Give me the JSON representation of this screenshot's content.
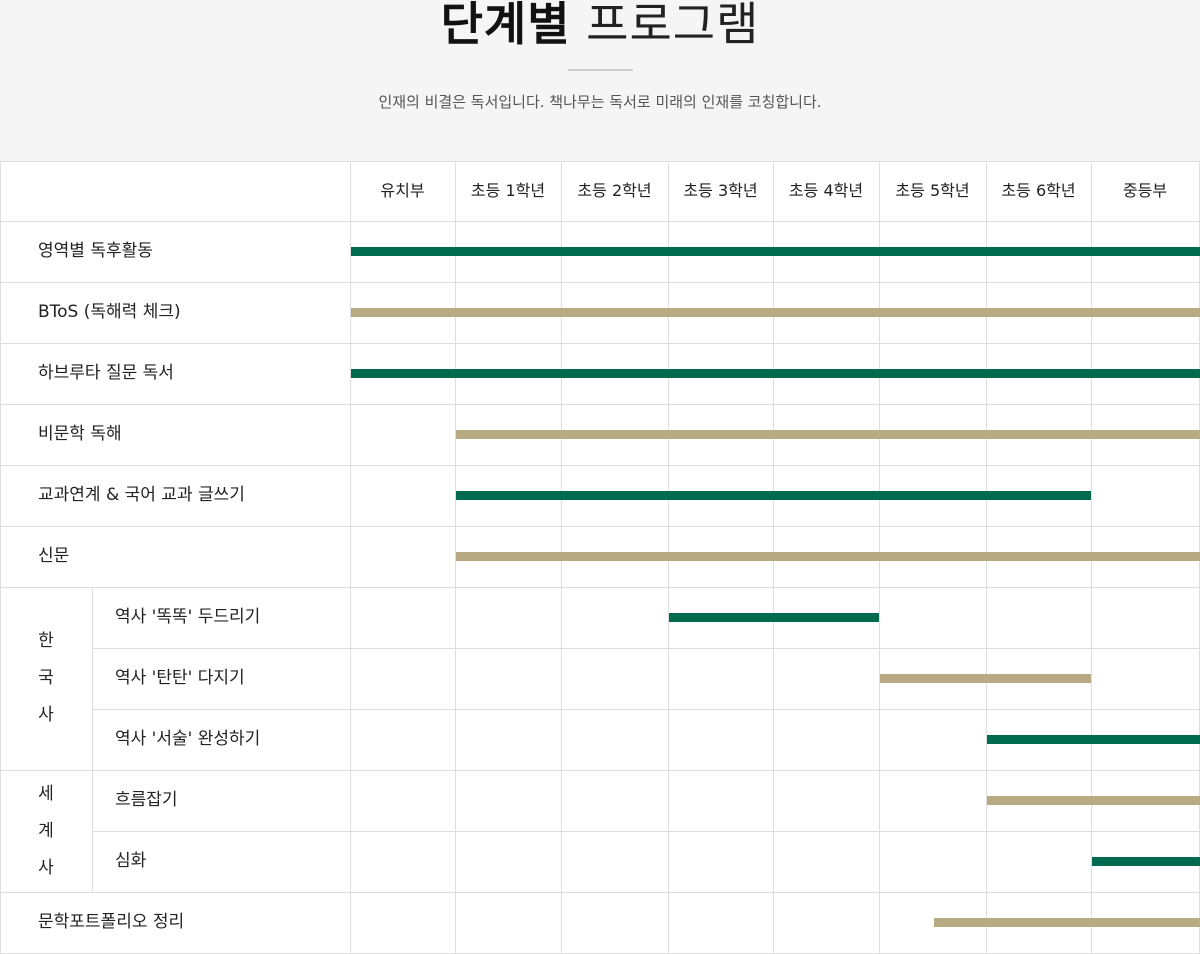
{
  "header": {
    "title_bold": "단계별",
    "title_light": "프로그램",
    "subtitle": "인재의 비결은 독서입니다. 책나무는 독서로 미래의 인재를 코칭합니다."
  },
  "colors": {
    "green": "#006b4f",
    "tan": "#b8ab84"
  },
  "columns": [
    "유치부",
    "초등 1학년",
    "초등 2학년",
    "초등 3학년",
    "초등 4학년",
    "초등 5학년",
    "초등 6학년",
    "중등부"
  ],
  "groups": [
    {
      "label_chars": [
        "한",
        "국",
        "사"
      ]
    },
    {
      "label_chars": [
        "세",
        "계",
        "사"
      ]
    }
  ],
  "rows": [
    {
      "label": "영역별 독후활동",
      "start": 0,
      "end": 8,
      "color": "green"
    },
    {
      "label": "BToS (독해력 체크)",
      "start": 0,
      "end": 8,
      "color": "tan"
    },
    {
      "label": "하브루타 질문 독서",
      "start": 0,
      "end": 8,
      "color": "green"
    },
    {
      "label": "비문학 독해",
      "start": 1,
      "end": 8,
      "color": "tan"
    },
    {
      "label": "교과연계 & 국어 교과 글쓰기",
      "start": 1,
      "end": 7,
      "color": "green"
    },
    {
      "label": "신문",
      "start": 1,
      "end": 8,
      "color": "tan"
    },
    {
      "label": "역사 '똑똑' 두드리기",
      "start": 3,
      "end": 5,
      "color": "green"
    },
    {
      "label": "역사 '탄탄' 다지기",
      "start": 5,
      "end": 7,
      "color": "tan"
    },
    {
      "label": "역사 '서술' 완성하기",
      "start": 6,
      "end": 8,
      "color": "green"
    },
    {
      "label": "흐름잡기",
      "start": 6,
      "end": 8,
      "color": "tan"
    },
    {
      "label": "심화",
      "start": 7,
      "end": 8,
      "color": "green"
    },
    {
      "label": "문학포트폴리오 정리",
      "start": 5.5,
      "end": 8,
      "color": "tan"
    }
  ]
}
